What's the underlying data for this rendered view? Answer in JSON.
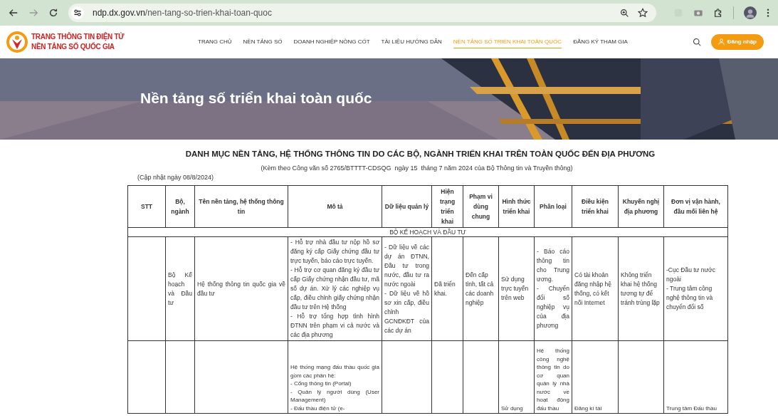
{
  "browser": {
    "url_host": "ndp.dx.gov.vn",
    "url_path": "/nen-tang-so-trien-khai-toan-quoc"
  },
  "site": {
    "logo_lines": [
      "TRANG THÔNG TIN ĐIỆN TỬ",
      "NỀN TẢNG SỐ QUỐC GIA"
    ],
    "nav": [
      {
        "label": "TRANG CHỦ",
        "selected": false
      },
      {
        "label": "NỀN TẢNG SỐ",
        "selected": false
      },
      {
        "label": "DOANH NGHIỆP NÒNG CỐT",
        "selected": false
      },
      {
        "label": "TÀI LIỆU HƯỚNG DẪN",
        "selected": false
      },
      {
        "label": "NỀN TẢNG SỐ TRIỂN KHAI TOÀN QUỐC",
        "selected": true
      },
      {
        "label": "ĐĂNG KÝ THAM GIA",
        "selected": false
      }
    ],
    "login_button": "Đăng nhập"
  },
  "banner": {
    "kind": "picture",
    "title": "Nền tảng số triển khai toàn quốc"
  },
  "document": {
    "title": "DANH MỤC NỀN TẢNG, HỆ THỐNG THÔNG TIN DO CÁC BỘ, NGÀNH TRIỂN KHAI TRÊN TOÀN QUỐC ĐẾN ĐỊA PHƯƠNG",
    "subtitle": "(Kèm theo Công văn số 2765/BTTTT-CDSQG  ngày 15  tháng 7 năm 2024 của Bộ Thông tin và Truyền thông)",
    "updated": "(Cập nhật ngày 08/8/2024)"
  },
  "table": {
    "columns": [
      "STT",
      "Bộ, ngành",
      "Tên nền tảng, hệ thống thông tin",
      "Mô tả",
      "Dữ liệu quản lý",
      "Hiện trạng triển khai",
      "Phạm vi dùng chung",
      "Hình thức triển khai",
      "Phân loại",
      "Điều kiện triển khai",
      "Khuyến nghị địa phương",
      "Đơn vị vận hành, đầu mối liên hệ"
    ],
    "rows": [
      {
        "kind": "section",
        "label": "BỘ KẾ HOẠCH VÀ ĐẦU TƯ"
      },
      {
        "kind": "data",
        "cells": [
          null,
          "Bộ Kế hoạch và Đầu tư",
          "Hệ thống thông tin quốc gia về đầu tư",
          "- Hỗ trợ nhà đầu tư nộp hồ sơ đăng ký cấp Giấy chứng đầu tư trực tuyến, báo cáo trực tuyến.\n- Hỗ trợ cơ quan đăng ký đầu tư cấp Giấy chứng nhận đầu tư, mã số dự án. Xử lý các nghiệp vụ cấp, điều chỉnh giấy chứng nhận đầu tư trên Hệ thống\n- Hỗ trợ tổng hợp tình hình ĐTNN trên phạm vi cả nước và các địa phương",
          "- Dữ liệu về các dự án ĐTNN, Đầu tư trong nước, đầu tư ra nước ngoài\n- Dữ liệu về hồ sơ xin cấp, điều chỉnh GCNĐKĐT của các dự án",
          "Đã triển khai.",
          "Đến cấp tỉnh, tất cả các doanh nghiệp",
          "Sử dụng trực tuyến trên web",
          "- Báo cáo thông tin cho Trung ương.\n- Chuyển đổi số nghiệp vụ của địa phương",
          "Có tài khoản đăng nhập hệ thống, có kết nối Internet",
          "Không triển khai hệ thống tương tự để tránh trùng lặp",
          "-Cục Đầu tư nước ngoài\n- Trung tâm công nghệ thông tin và chuyển đổi số"
        ]
      },
      {
        "kind": "data",
        "cells": [
          null,
          null,
          null,
          "Hệ thống mạng đấu thầu quốc gia gồm các phân hệ:\n- Cổng thông tin (Portal)\n- Quản lý người dùng (User Management)\n- Đấu thầu điện tử (e-",
          null,
          null,
          null,
          "Sử dụng",
          "Hệ thống công nghệ thông tin do cơ quan quản lý nhà nước về hoạt động đấu thầu",
          "Đăng kí tài",
          null,
          "Trung tâm Đấu thầu"
        ]
      }
    ]
  }
}
